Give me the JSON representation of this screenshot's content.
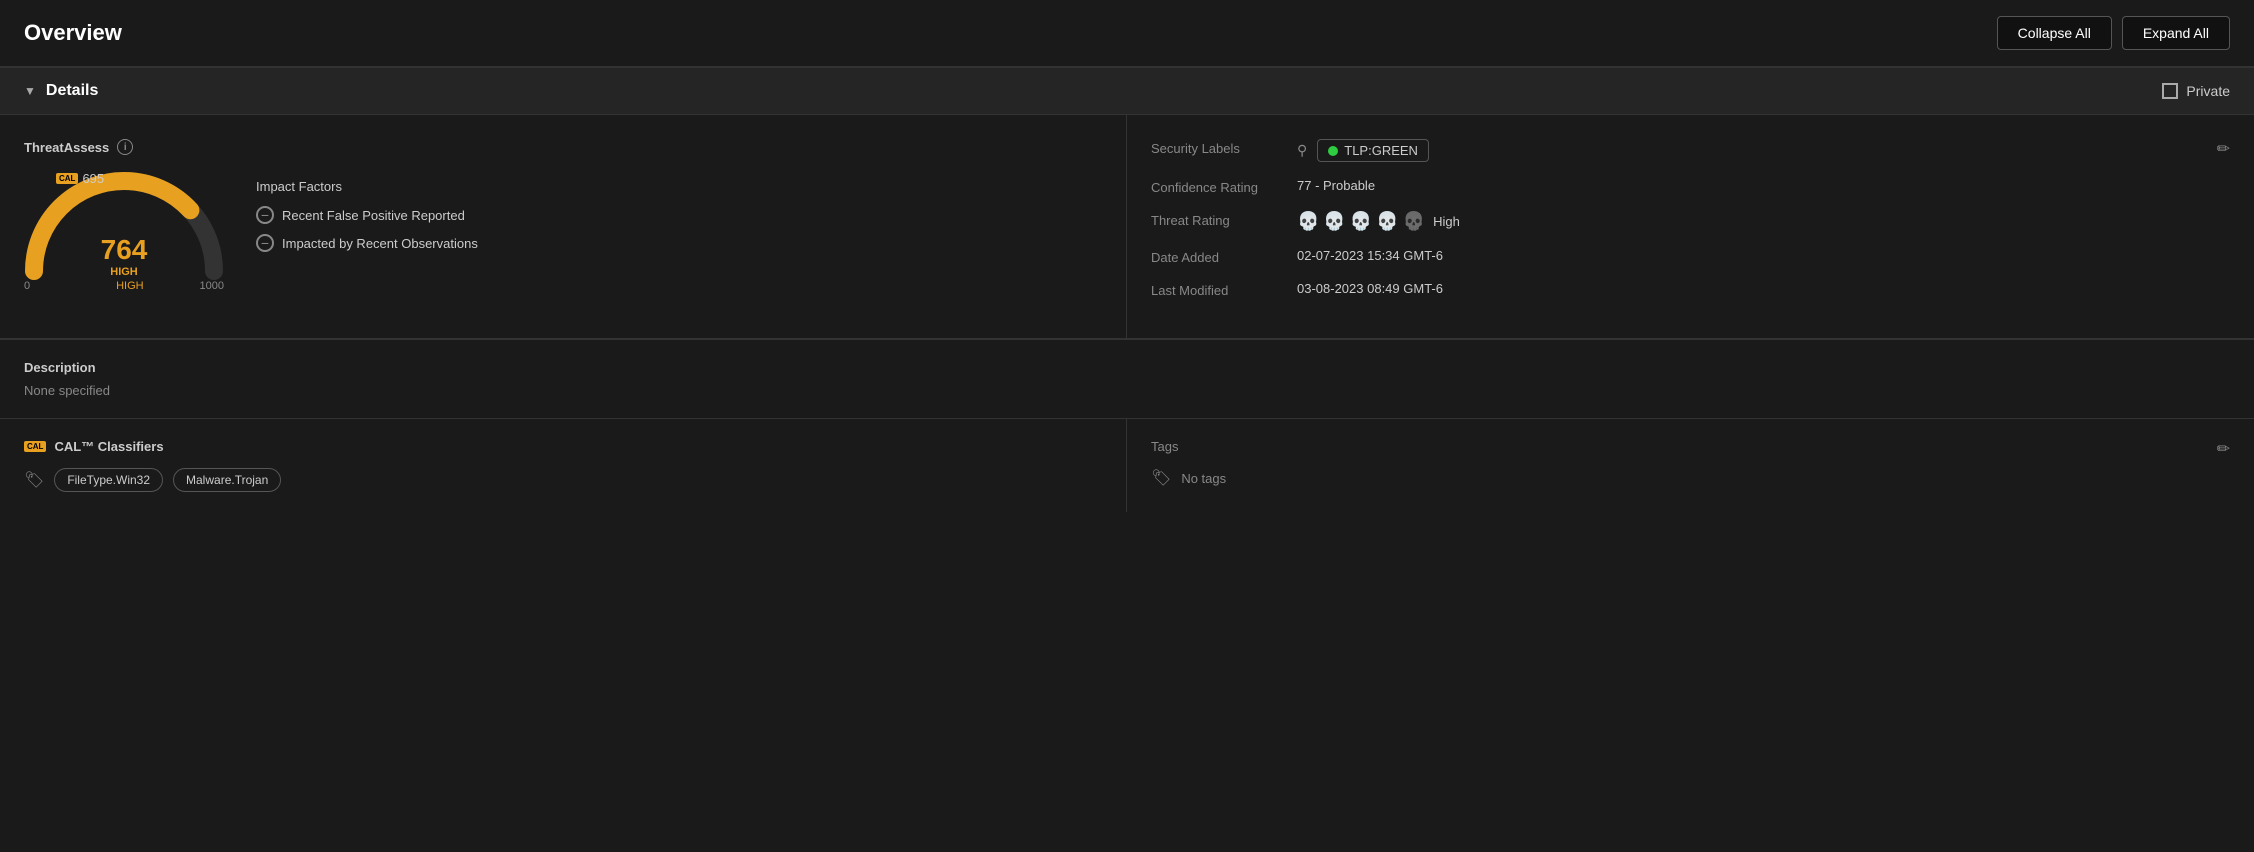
{
  "header": {
    "title": "Overview",
    "collapse_label": "Collapse All",
    "expand_label": "Expand All"
  },
  "details": {
    "section_title": "Details",
    "private_label": "Private",
    "threat_assess": {
      "label": "ThreatAssess",
      "cal_tag": "CAL",
      "score_cal": "695",
      "score_main": "764",
      "rating": "HIGH",
      "scale_min": "0",
      "scale_max": "1000",
      "impact_factors_title": "Impact Factors",
      "impact_factors": [
        "Recent False Positive Reported",
        "Impacted by Recent Observations"
      ]
    },
    "description": {
      "label": "Description",
      "value": "None specified"
    },
    "security_labels": {
      "label": "Security Labels",
      "tlp_text": "TLP:GREEN"
    },
    "confidence_rating": {
      "label": "Confidence Rating",
      "value": "77 - Probable"
    },
    "threat_rating": {
      "label": "Threat Rating",
      "skulls_active": 4,
      "skulls_total": 5,
      "text": "High"
    },
    "date_added": {
      "label": "Date Added",
      "value": "02-07-2023 15:34 GMT-6"
    },
    "last_modified": {
      "label": "Last Modified",
      "value": "03-08-2023 08:49 GMT-6"
    },
    "cal_classifiers": {
      "label": "CAL™ Classifiers",
      "cal_tag": "CAL",
      "chips": [
        "FileType.Win32",
        "Malware.Trojan"
      ]
    },
    "tags": {
      "label": "Tags",
      "value": "No tags"
    }
  }
}
